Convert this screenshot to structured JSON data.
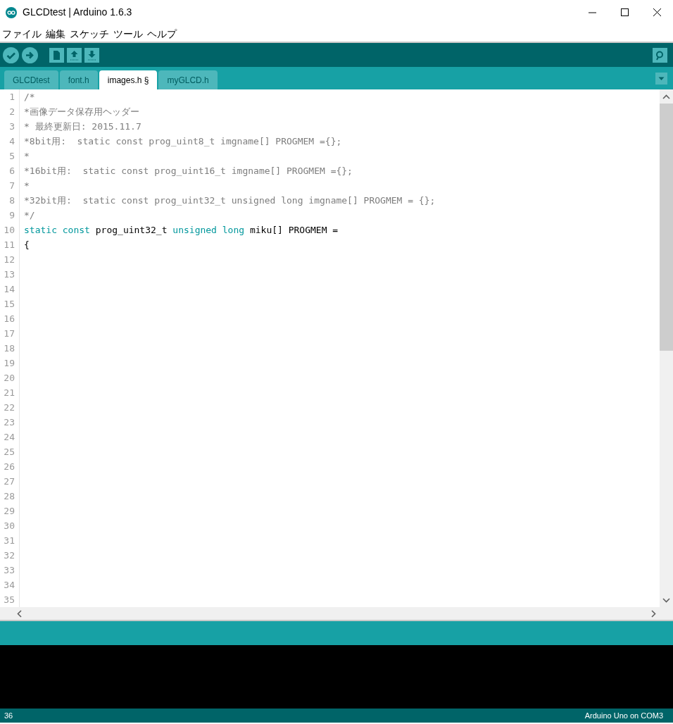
{
  "window": {
    "title": "GLCDtest | Arduino 1.6.3"
  },
  "menu": [
    "ファイル",
    "編集",
    "スケッチ",
    "ツール",
    "ヘルプ"
  ],
  "tabs": [
    {
      "label": "GLCDtest",
      "selected": false
    },
    {
      "label": "font.h",
      "selected": false
    },
    {
      "label": "images.h §",
      "selected": true
    },
    {
      "label": "myGLCD.h",
      "selected": false
    }
  ],
  "editor": {
    "lines": [
      {
        "number": "1",
        "tokens": [
          {
            "kind": "comment",
            "text": "/*"
          }
        ]
      },
      {
        "number": "2",
        "tokens": [
          {
            "kind": "comment",
            "text": "*画像データ保存用ヘッダー"
          }
        ]
      },
      {
        "number": "3",
        "tokens": [
          {
            "kind": "comment",
            "text": "* 最終更新日: 2015.11.7"
          }
        ]
      },
      {
        "number": "4",
        "tokens": [
          {
            "kind": "comment",
            "text": "*8bit用:  static const prog_uint8_t imgname[] PROGMEM ={};"
          }
        ]
      },
      {
        "number": "5",
        "tokens": [
          {
            "kind": "comment",
            "text": "*"
          }
        ]
      },
      {
        "number": "6",
        "tokens": [
          {
            "kind": "comment",
            "text": "*16bit用:  static const prog_uint16_t imgname[] PROGMEM ={};"
          }
        ]
      },
      {
        "number": "7",
        "tokens": [
          {
            "kind": "comment",
            "text": "*"
          }
        ]
      },
      {
        "number": "8",
        "tokens": [
          {
            "kind": "comment",
            "text": "*32bit用:  static const prog_uint32_t unsigned long imgname[] PROGMEM = {};"
          }
        ]
      },
      {
        "number": "9",
        "tokens": [
          {
            "kind": "comment",
            "text": "*/"
          }
        ]
      },
      {
        "number": "10",
        "tokens": [
          {
            "kind": "keyword",
            "text": "static const"
          },
          {
            "kind": "plain",
            "text": " prog_uint32_t "
          },
          {
            "kind": "keyword",
            "text": "unsigned long"
          },
          {
            "kind": "plain",
            "text": " miku[] PROGMEM ="
          }
        ]
      },
      {
        "number": "11",
        "tokens": [
          {
            "kind": "plain",
            "text": "{"
          }
        ]
      },
      {
        "number": "12"
      },
      {
        "number": "13"
      },
      {
        "number": "14"
      },
      {
        "number": "15"
      },
      {
        "number": "16"
      },
      {
        "number": "17"
      },
      {
        "number": "18"
      },
      {
        "number": "19"
      },
      {
        "number": "20"
      },
      {
        "number": "21"
      },
      {
        "number": "22"
      },
      {
        "number": "23"
      },
      {
        "number": "24"
      },
      {
        "number": "25"
      },
      {
        "number": "26"
      },
      {
        "number": "27"
      },
      {
        "number": "28"
      },
      {
        "number": "29"
      },
      {
        "number": "30"
      },
      {
        "number": "31"
      },
      {
        "number": "32"
      },
      {
        "number": "33"
      },
      {
        "number": "34"
      },
      {
        "number": "35"
      }
    ]
  },
  "status_bar": {
    "line": "36",
    "board": "Arduino Uno on COM3"
  }
}
